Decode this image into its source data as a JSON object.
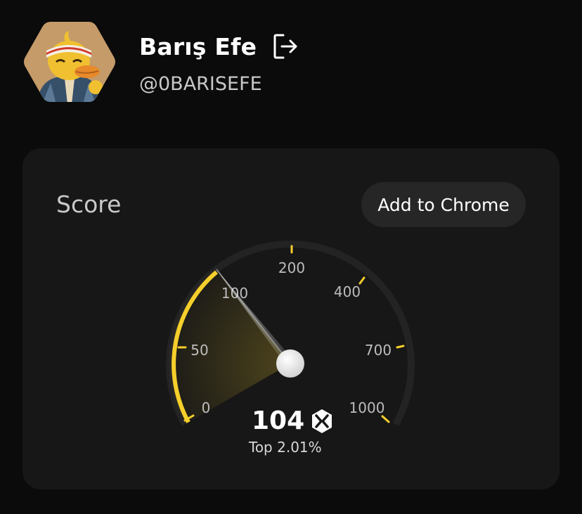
{
  "profile": {
    "name": "Barış Efe",
    "handle": "@0BARISEFE"
  },
  "score_card": {
    "title": "Score",
    "add_button_label": "Add to Chrome",
    "gauge": {
      "ticks": [
        "0",
        "50",
        "100",
        "200",
        "400",
        "700",
        "1000"
      ],
      "value": 104,
      "value_label": "104",
      "rank_label": "Top 2.01%"
    }
  },
  "colors": {
    "background": "#0b0b0b",
    "card": "#171717",
    "accent": "#f5cf2b",
    "track": "#232323",
    "button": "#262626"
  },
  "icons": {
    "logout": "logout-icon",
    "brand": "xs-logo-icon"
  }
}
